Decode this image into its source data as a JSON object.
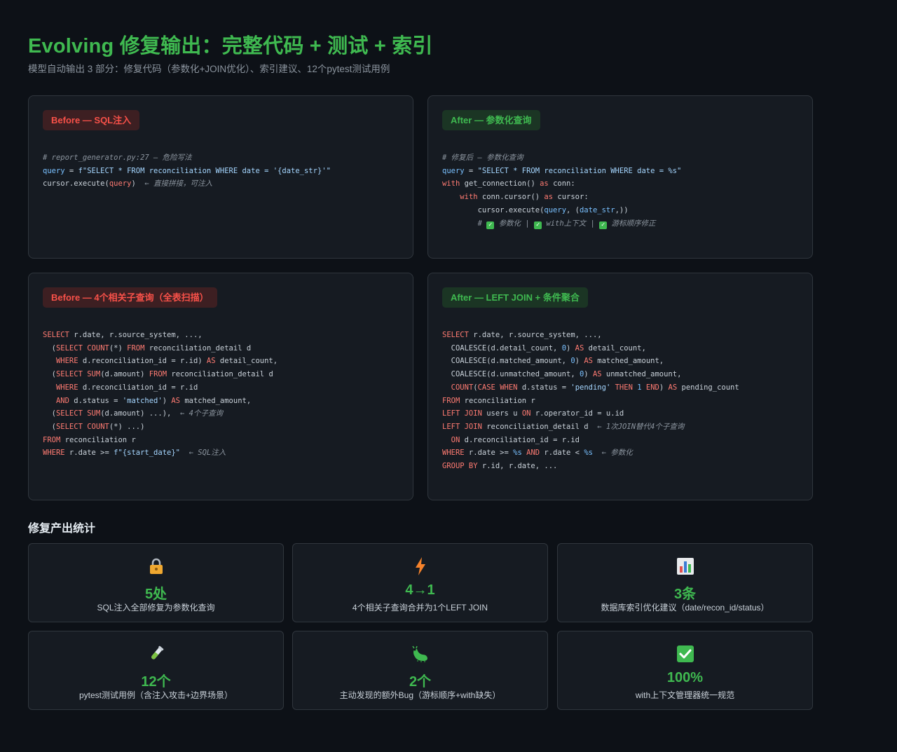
{
  "header": {
    "title": "Evolving 修复输出：完整代码 + 测试 + 索引",
    "subtitle": "模型自动输出 3 部分：修复代码（参数化+JOIN优化）、索引建议、12个pytest测试用例"
  },
  "panels": {
    "sql_before": {
      "badge": "Before — SQL注入",
      "comment": "# report_generator.py:27 — 危险写法",
      "line2_var": "query",
      "line2_eq": " = ",
      "line2_str": "f\"SELECT * FROM reconciliation WHERE date = '{date_str}'\"",
      "line3_code": "cursor.execute(",
      "line3_arg": "query",
      "line3_close": ")",
      "line3_note": "  ← 直接拼接，可注入"
    },
    "sql_after": {
      "badge": "After — 参数化查询",
      "comment": "# 修复后 — 参数化查询",
      "line2_var": "query",
      "line2_eq": " = ",
      "line2_str": "\"SELECT * FROM reconciliation WHERE date = %s\"",
      "line3_kw": "with",
      "line3_code": " get_connection() ",
      "line3_as": "as",
      "line3_tail": " conn:",
      "line4_indent": "    ",
      "line4_kw": "with",
      "line4_code": " conn.cursor() ",
      "line4_as": "as",
      "line4_tail": " cursor:",
      "line5_code": "        cursor.execute(",
      "line5_arg": "query",
      "line5_tail": ", (",
      "line5_arg2": "date_str",
      "line5_close": ",))",
      "line6_indent": "        ",
      "line6_hash": "# ",
      "check1": "参数化",
      "check2": "with上下文",
      "check3": "游标顺序修正",
      "sep": " | "
    },
    "join_before": {
      "badge": "Before — 4个相关子查询（全表扫描）",
      "lines": [
        [
          [
            "kw",
            "SELECT"
          ],
          [
            "p",
            " r.date, r.source_system, ...,"
          ]
        ],
        [
          [
            "p",
            "  ("
          ],
          [
            "kw",
            "SELECT"
          ],
          [
            "p",
            " "
          ],
          [
            "kw",
            "COUNT"
          ],
          [
            "p",
            "(*) "
          ],
          [
            "kw",
            "FROM"
          ],
          [
            "p",
            " reconciliation_detail d"
          ]
        ],
        [
          [
            "p",
            "   "
          ],
          [
            "kw",
            "WHERE"
          ],
          [
            "p",
            " d.reconciliation_id = r.id) "
          ],
          [
            "kw",
            "AS"
          ],
          [
            "p",
            " detail_count,"
          ]
        ],
        [
          [
            "p",
            "  ("
          ],
          [
            "kw",
            "SELECT"
          ],
          [
            "p",
            " "
          ],
          [
            "kw",
            "SUM"
          ],
          [
            "p",
            "(d.amount) "
          ],
          [
            "kw",
            "FROM"
          ],
          [
            "p",
            " reconciliation_detail d"
          ]
        ],
        [
          [
            "p",
            "   "
          ],
          [
            "kw",
            "WHERE"
          ],
          [
            "p",
            " d.reconciliation_id = r.id"
          ]
        ],
        [
          [
            "p",
            "   "
          ],
          [
            "kw",
            "AND"
          ],
          [
            "p",
            " d.status = "
          ],
          [
            "str",
            "'matched'"
          ],
          [
            "p",
            ") "
          ],
          [
            "kw",
            "AS"
          ],
          [
            "p",
            " matched_amount,"
          ]
        ],
        [
          [
            "p",
            "  ("
          ],
          [
            "kw",
            "SELECT"
          ],
          [
            "p",
            " "
          ],
          [
            "kw",
            "SUM"
          ],
          [
            "p",
            "(d.amount) ...),"
          ],
          [
            "cm",
            "  ← 4个子查询"
          ]
        ],
        [
          [
            "p",
            "  ("
          ],
          [
            "kw",
            "SELECT"
          ],
          [
            "p",
            " "
          ],
          [
            "kw",
            "COUNT"
          ],
          [
            "p",
            "(*) ...)"
          ]
        ],
        [
          [
            "kw",
            "FROM"
          ],
          [
            "p",
            " reconciliation r"
          ]
        ],
        [
          [
            "kw",
            "WHERE"
          ],
          [
            "p",
            " r.date >= "
          ],
          [
            "str",
            "f\"{start_date}\""
          ],
          [
            "cm",
            "  ← SQL注入"
          ]
        ]
      ]
    },
    "join_after": {
      "badge": "After — LEFT JOIN + 条件聚合",
      "lines": [
        [
          [
            "kw",
            "SELECT"
          ],
          [
            "p",
            " r.date, r.source_system, ...,"
          ]
        ],
        [
          [
            "p",
            "  COALESCE(d.detail_count, "
          ],
          [
            "num",
            "0"
          ],
          [
            "p",
            ") "
          ],
          [
            "kw",
            "AS"
          ],
          [
            "p",
            " detail_count,"
          ]
        ],
        [
          [
            "p",
            "  COALESCE(d.matched_amount, "
          ],
          [
            "num",
            "0"
          ],
          [
            "p",
            ") "
          ],
          [
            "kw",
            "AS"
          ],
          [
            "p",
            " matched_amount,"
          ]
        ],
        [
          [
            "p",
            "  COALESCE(d.unmatched_amount, "
          ],
          [
            "num",
            "0"
          ],
          [
            "p",
            ") "
          ],
          [
            "kw",
            "AS"
          ],
          [
            "p",
            " unmatched_amount,"
          ]
        ],
        [
          [
            "p",
            "  "
          ],
          [
            "kw",
            "COUNT"
          ],
          [
            "p",
            "("
          ],
          [
            "kw",
            "CASE"
          ],
          [
            "p",
            " "
          ],
          [
            "kw",
            "WHEN"
          ],
          [
            "p",
            " d.status = "
          ],
          [
            "str",
            "'pending'"
          ],
          [
            "p",
            " "
          ],
          [
            "kw",
            "THEN"
          ],
          [
            "p",
            " "
          ],
          [
            "num",
            "1"
          ],
          [
            "p",
            " "
          ],
          [
            "kw",
            "END"
          ],
          [
            "p",
            ") "
          ],
          [
            "kw",
            "AS"
          ],
          [
            "p",
            " pending_count"
          ]
        ],
        [
          [
            "kw",
            "FROM"
          ],
          [
            "p",
            " reconciliation r"
          ]
        ],
        [
          [
            "kw",
            "LEFT JOIN"
          ],
          [
            "p",
            " users u "
          ],
          [
            "kw",
            "ON"
          ],
          [
            "p",
            " r.operator_id = u.id"
          ]
        ],
        [
          [
            "kw",
            "LEFT JOIN"
          ],
          [
            "p",
            " reconciliation_detail d"
          ],
          [
            "cm",
            "  ← 1次JOIN替代4个子查询"
          ]
        ],
        [
          [
            "p",
            "  "
          ],
          [
            "kw",
            "ON"
          ],
          [
            "p",
            " d.reconciliation_id = r.id"
          ]
        ],
        [
          [
            "kw",
            "WHERE"
          ],
          [
            "p",
            " r.date >= "
          ],
          [
            "var",
            "%s"
          ],
          [
            "p",
            " "
          ],
          [
            "kw",
            "AND"
          ],
          [
            "p",
            " r.date < "
          ],
          [
            "var",
            "%s"
          ],
          [
            "cm",
            "  ← 参数化"
          ]
        ],
        [
          [
            "kw",
            "GROUP BY"
          ],
          [
            "p",
            " r.id, r.date, ..."
          ]
        ]
      ]
    }
  },
  "stats": {
    "title": "修复产出统计",
    "cards": [
      {
        "icon": "lock-icon",
        "value": "5处",
        "desc": "SQL注入全部修复为参数化查询"
      },
      {
        "icon": "lightning-icon",
        "value": "4→1",
        "desc": "4个相关子查询合并为1个LEFT JOIN"
      },
      {
        "icon": "bar-chart-icon",
        "value": "3条",
        "desc": "数据库索引优化建议（date/recon_id/status）"
      },
      {
        "icon": "test-tube-icon",
        "value": "12个",
        "desc": "pytest测试用例（含注入攻击+边界场景）"
      },
      {
        "icon": "bug-icon",
        "value": "2个",
        "desc": "主动发现的额外Bug（游标顺序+with缺失）"
      },
      {
        "icon": "check-icon",
        "value": "100%",
        "desc": "with上下文管理器统一规范"
      }
    ]
  },
  "colors": {
    "accent": "#3fb950",
    "danger": "#f85149",
    "background": "#0d1117",
    "panel": "#161b22"
  }
}
